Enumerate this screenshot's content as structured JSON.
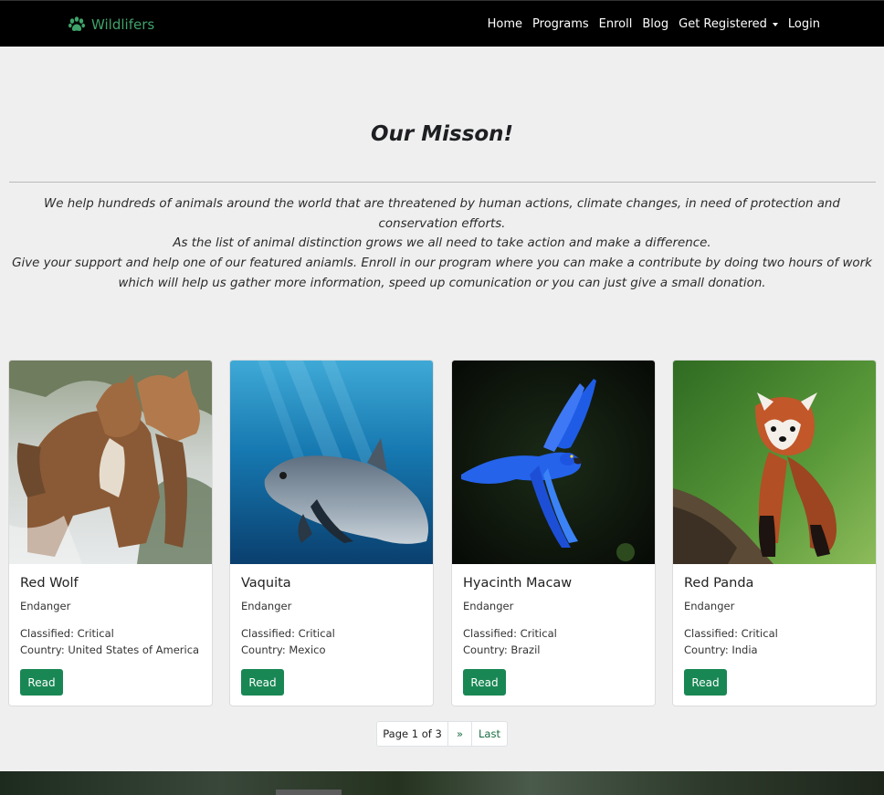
{
  "nav": {
    "brand": "Wildlifers",
    "links": [
      "Home",
      "Programs",
      "Enroll",
      "Blog",
      "Get Registered",
      "Login"
    ]
  },
  "mission": {
    "title": "Our Misson!",
    "line1": "We help hundreds of animals around the world that are threatened by human actions, climate changes, in need of protection and conservation efforts.",
    "line2": "As the list of animal distinction grows we all need to take action and make a difference.",
    "line3": "Give your support and help one of our featured aniamls. Enroll in our program where you can make a contribute by doing two hours of work which will help us gather more information, speed up comunication or you can just give a small donation."
  },
  "cards": [
    {
      "name": "Red Wolf",
      "status": "Endanger",
      "classified": "Classified: Critical",
      "country": "Country: United States of America",
      "button": "Read"
    },
    {
      "name": "Vaquita",
      "status": "Endanger",
      "classified": "Classified: Critical",
      "country": "Country: Mexico",
      "button": "Read"
    },
    {
      "name": "Hyacinth Macaw",
      "status": "Endanger",
      "classified": "Classified: Critical",
      "country": "Country: Brazil",
      "button": "Read"
    },
    {
      "name": "Red Panda",
      "status": "Endanger",
      "classified": "Classified: Critical",
      "country": "Country: India",
      "button": "Read"
    }
  ],
  "pagination": {
    "current": "Page 1 of 3",
    "next": "»",
    "last": "Last"
  },
  "colors": {
    "brand": "#3fa26a",
    "button": "#198754",
    "navbar": "#000000",
    "background": "#efefef"
  }
}
